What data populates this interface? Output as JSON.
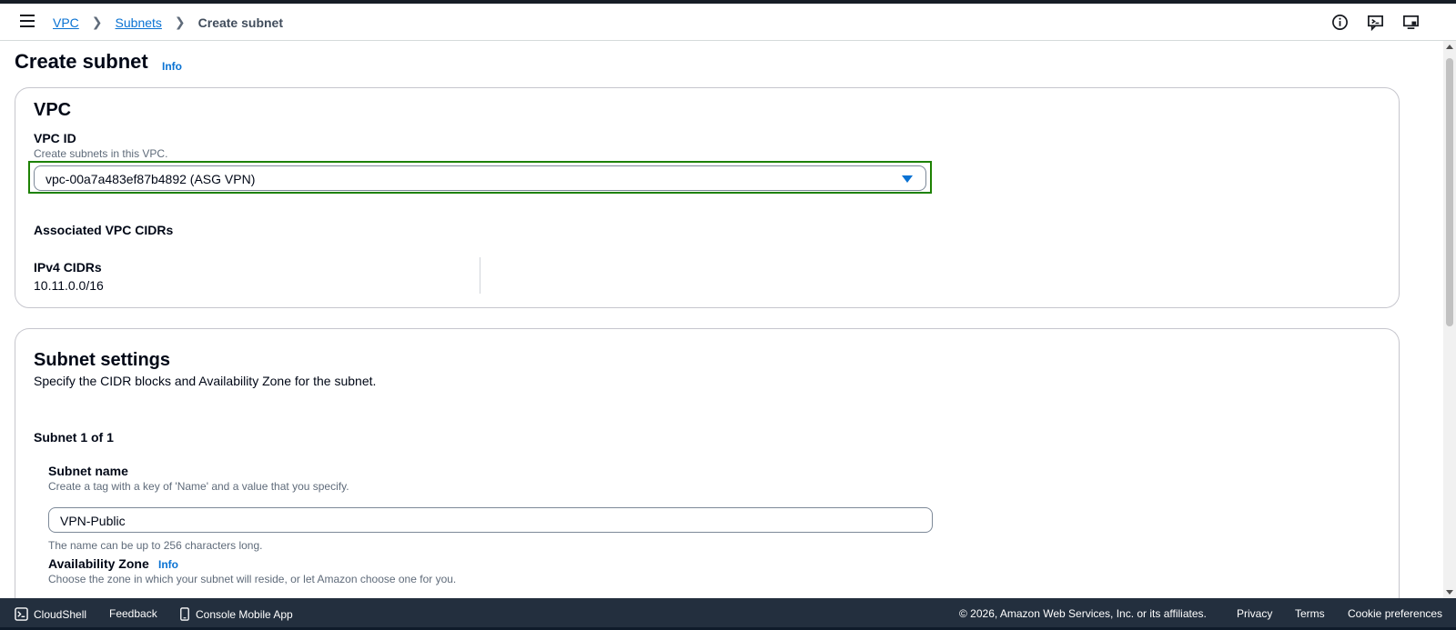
{
  "breadcrumb": {
    "items": [
      "VPC",
      "Subnets"
    ],
    "current": "Create subnet"
  },
  "header_icons": [
    "info-circle-icon",
    "feedback-icon",
    "screen-icon"
  ],
  "page": {
    "title": "Create subnet",
    "info_label": "Info"
  },
  "vpc_section": {
    "heading": "VPC",
    "vpc_id_label": "VPC ID",
    "vpc_id_description": "Create subnets in this VPC.",
    "vpc_id_value": "vpc-00a7a483ef87b4892 (ASG VPN)",
    "associated_label": "Associated VPC CIDRs",
    "ipv4_label": "IPv4 CIDRs",
    "ipv4_value": "10.11.0.0/16"
  },
  "subnet_section": {
    "heading": "Subnet settings",
    "description": "Specify the CIDR blocks and Availability Zone for the subnet.",
    "counter": "Subnet 1 of 1",
    "name_label": "Subnet name",
    "name_description": "Create a tag with a key of 'Name' and a value that you specify.",
    "name_value": "VPN-Public",
    "name_constraint": "The name can be up to 256 characters long.",
    "az_label": "Availability Zone",
    "az_info": "Info",
    "az_description": "Choose the zone in which your subnet will reside, or let Amazon choose one for you."
  },
  "footer": {
    "cloudshell": "CloudShell",
    "feedback": "Feedback",
    "mobile_app": "Console Mobile App",
    "copyright": "© 2026, Amazon Web Services, Inc. or its affiliates.",
    "privacy": "Privacy",
    "terms": "Terms",
    "cookies": "Cookie preferences"
  },
  "colors": {
    "link": "#0972d3",
    "highlight_border": "#1d8102",
    "footer_bg": "#232f3e"
  }
}
